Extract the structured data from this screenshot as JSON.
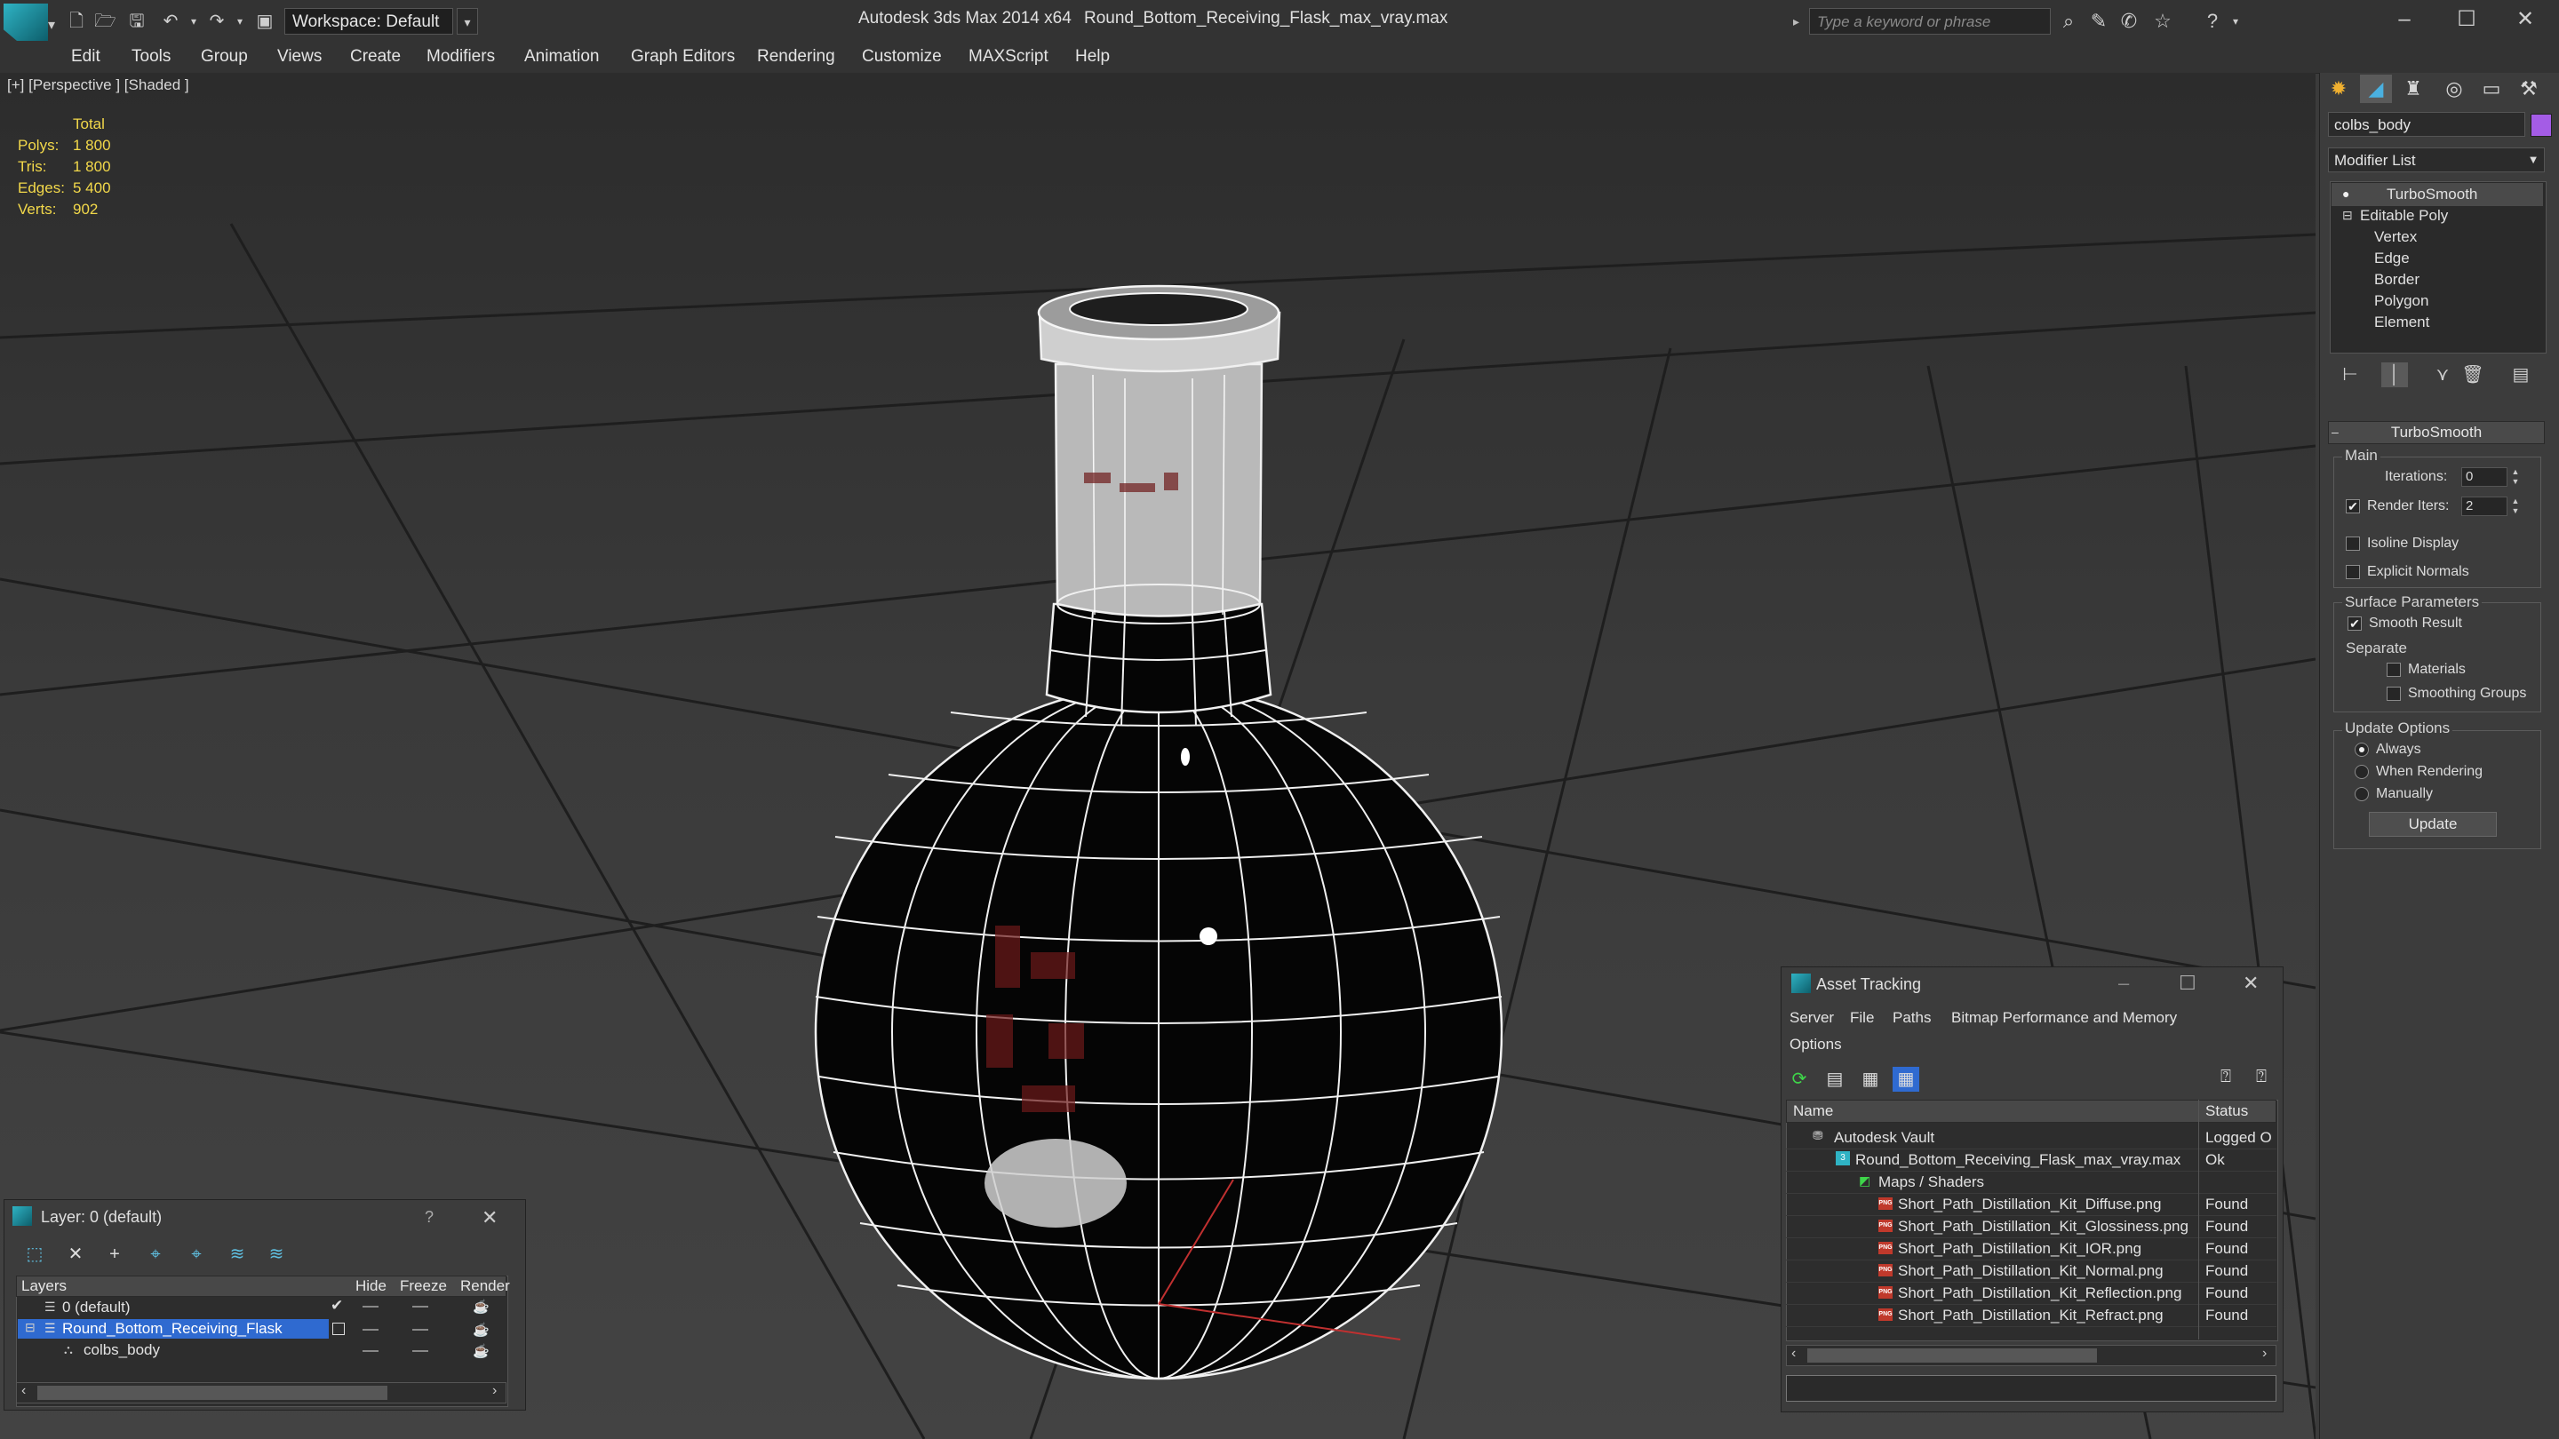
{
  "app": {
    "title": "Autodesk 3ds Max 2014 x64",
    "file": "Round_Bottom_Receiving_Flask_max_vray.max",
    "workspace": "Workspace: Default",
    "search_placeholder": "Type a keyword or phrase"
  },
  "menu": [
    "Edit",
    "Tools",
    "Group",
    "Views",
    "Create",
    "Modifiers",
    "Animation",
    "Graph Editors",
    "Rendering",
    "Customize",
    "MAXScript",
    "Help"
  ],
  "viewport": {
    "label": "[+] [Perspective ] [Shaded ]",
    "stats": {
      "header": "Total",
      "rows": [
        {
          "label": "Polys:",
          "value": "1 800"
        },
        {
          "label": "Tris:",
          "value": "1 800"
        },
        {
          "label": "Edges:",
          "value": "5 400"
        },
        {
          "label": "Verts:",
          "value": "902"
        }
      ]
    }
  },
  "command_panel": {
    "object_name": "colbs_body",
    "object_color": "#a45ce6",
    "modifier_list_label": "Modifier List",
    "stack": [
      "TurboSmooth",
      "Editable Poly",
      "Vertex",
      "Edge",
      "Border",
      "Polygon",
      "Element"
    ],
    "rollout": {
      "title": "TurboSmooth",
      "main_label": "Main",
      "iterations_label": "Iterations:",
      "iterations_value": "0",
      "render_iters_label": "Render Iters:",
      "render_iters_value": "2",
      "isoline_label": "Isoline Display",
      "explicit_normals_label": "Explicit Normals",
      "surface_label": "Surface Parameters",
      "smooth_result_label": "Smooth Result",
      "separate_label": "Separate",
      "materials_label": "Materials",
      "smoothing_groups_label": "Smoothing Groups",
      "update_options_label": "Update Options",
      "always_label": "Always",
      "when_rendering_label": "When Rendering",
      "manually_label": "Manually",
      "update_button": "Update"
    }
  },
  "layer_window": {
    "title": "Layer: 0 (default)",
    "help": "?",
    "columns": [
      "Layers",
      "Hide",
      "Freeze",
      "Render"
    ],
    "rows": [
      "0 (default)",
      "Round_Bottom_Receiving_Flask",
      "colbs_body"
    ]
  },
  "asset_window": {
    "title": "Asset Tracking",
    "menu": [
      "Server",
      "File",
      "Paths",
      "Bitmap Performance and Memory",
      "Options"
    ],
    "columns": [
      "Name",
      "Status"
    ],
    "rows": [
      {
        "name": "Autodesk Vault",
        "status": "Logged O"
      },
      {
        "name": "Round_Bottom_Receiving_Flask_max_vray.max",
        "status": "Ok"
      },
      {
        "name": "Maps / Shaders",
        "status": ""
      },
      {
        "name": "Short_Path_Distillation_Kit_Diffuse.png",
        "status": "Found"
      },
      {
        "name": "Short_Path_Distillation_Kit_Glossiness.png",
        "status": "Found"
      },
      {
        "name": "Short_Path_Distillation_Kit_IOR.png",
        "status": "Found"
      },
      {
        "name": "Short_Path_Distillation_Kit_Normal.png",
        "status": "Found"
      },
      {
        "name": "Short_Path_Distillation_Kit_Reflection.png",
        "status": "Found"
      },
      {
        "name": "Short_Path_Distillation_Kit_Refract.png",
        "status": "Found"
      }
    ]
  },
  "icons": {
    "png_badge": "PNG"
  },
  "colors": {
    "selection": "#2f6ad0",
    "stats_text": "#f2d84a"
  }
}
